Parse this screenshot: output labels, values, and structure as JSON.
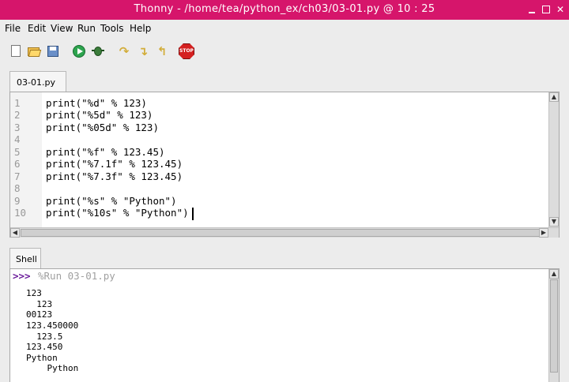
{
  "window": {
    "title": "Thonny  -  /home/tea/python_ex/ch03/03-01.py  @  10 : 25",
    "title_bar_color": "#d6156b"
  },
  "menu": [
    "File",
    "Edit",
    "View",
    "Run",
    "Tools",
    "Help"
  ],
  "toolbar": {
    "icons": [
      "new-file-icon",
      "open-file-icon",
      "save-file-icon",
      "run-icon",
      "debug-icon",
      "step-over-icon",
      "step-into-icon",
      "step-out-icon",
      "stop-icon"
    ],
    "stop_label": "STOP"
  },
  "editor": {
    "tab_label": "03-01.py",
    "line_numbers": [
      "1",
      "2",
      "3",
      "4",
      "5",
      "6",
      "7",
      "8",
      "9",
      "10"
    ],
    "lines": [
      "print(\"%d\" % 123)",
      "print(\"%5d\" % 123)",
      "print(\"%05d\" % 123)",
      "",
      "print(\"%f\" % 123.45)",
      "print(\"%7.1f\" % 123.45)",
      "print(\"%7.3f\" % 123.45)",
      "",
      "print(\"%s\" % \"Python\")",
      "print(\"%10s\" % \"Python\")"
    ]
  },
  "shell": {
    "tab_label": "Shell",
    "prompt": ">>>",
    "command": "%Run 03-01.py",
    "output": [
      "123",
      "  123",
      "00123",
      "123.450000",
      "  123.5",
      "123.450",
      "Python",
      "    Python"
    ]
  }
}
